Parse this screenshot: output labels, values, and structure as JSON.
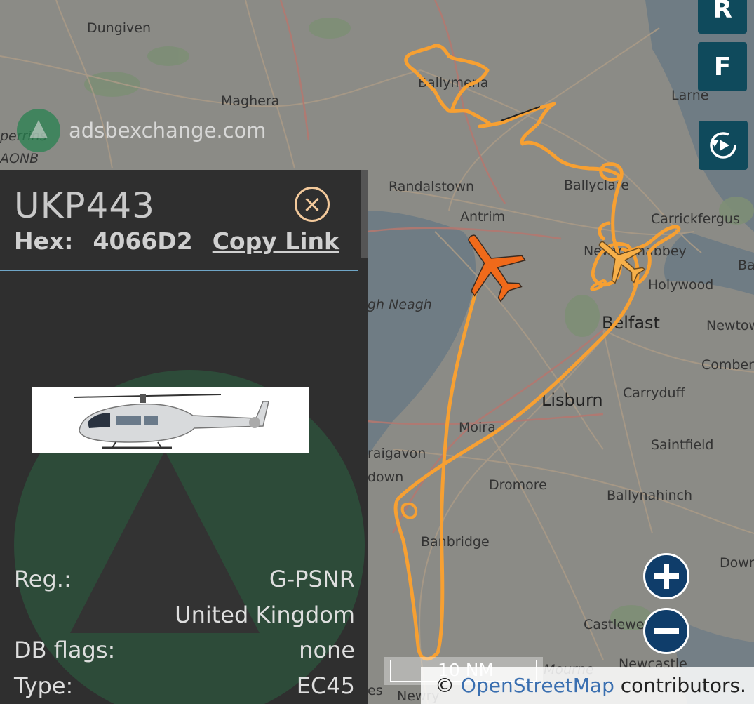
{
  "watermark": "adsbexchange.com",
  "map": {
    "places": {
      "dungiven": "Dungiven",
      "maghera": "Maghera",
      "aonb": "AONB",
      "perrins": "perrins",
      "ballymena": "Ballymena",
      "larne": "Larne",
      "randalstown": "Randalstown",
      "ballyclare": "Ballyclare",
      "antrim": "Antrim",
      "carrickfergus": "Carrickfergus",
      "newtownabbey": "Newtownabbey",
      "holywood": "Holywood",
      "ba": "Ba",
      "lough_neagh": "gh Neagh",
      "belfast": "Belfast",
      "newtow": "Newtow",
      "comber": "Comber",
      "lisburn": "Lisburn",
      "carryduff": "Carryduff",
      "moira": "Moira",
      "saintfield": "Saintfield",
      "craigavon": "raigavon",
      "down": "down",
      "dromore": "Dromore",
      "ballynahinch": "Ballynahinch",
      "banbridge": "Banbridge",
      "downpa": "Downpa",
      "castlewe": "Castlewe",
      "mourne": "Mourne",
      "newcastle": "Newcastle",
      "newry": "Newry",
      "es": "es"
    },
    "colors": {
      "track": "#f7a032",
      "aircraft_selected": "#f06a1a",
      "aircraft_other": "#f7b04a",
      "panel_bg": "#2f2f2f",
      "button_bg": "#0f4a5c"
    }
  },
  "controls": {
    "r_label": "R",
    "f_label": "F",
    "replay_icon": "replay-icon",
    "zoom_in_icon": "plus-icon",
    "zoom_out_icon": "minus-icon"
  },
  "panel": {
    "callsign": "UKP443",
    "hex_label": "Hex:",
    "hex_value": "4066D2",
    "copy_link": "Copy Link",
    "reg_label": "Reg.:",
    "reg_value": "G-PSNR",
    "country": "United Kingdom",
    "dbflags_label": "DB flags:",
    "dbflags_value": "none",
    "type_label": "Type:",
    "type_value": "EC45"
  },
  "scale": {
    "label": "10 NM"
  },
  "attribution": {
    "symbol": "©",
    "link": "OpenStreetMap",
    "suffix": "contributors."
  }
}
